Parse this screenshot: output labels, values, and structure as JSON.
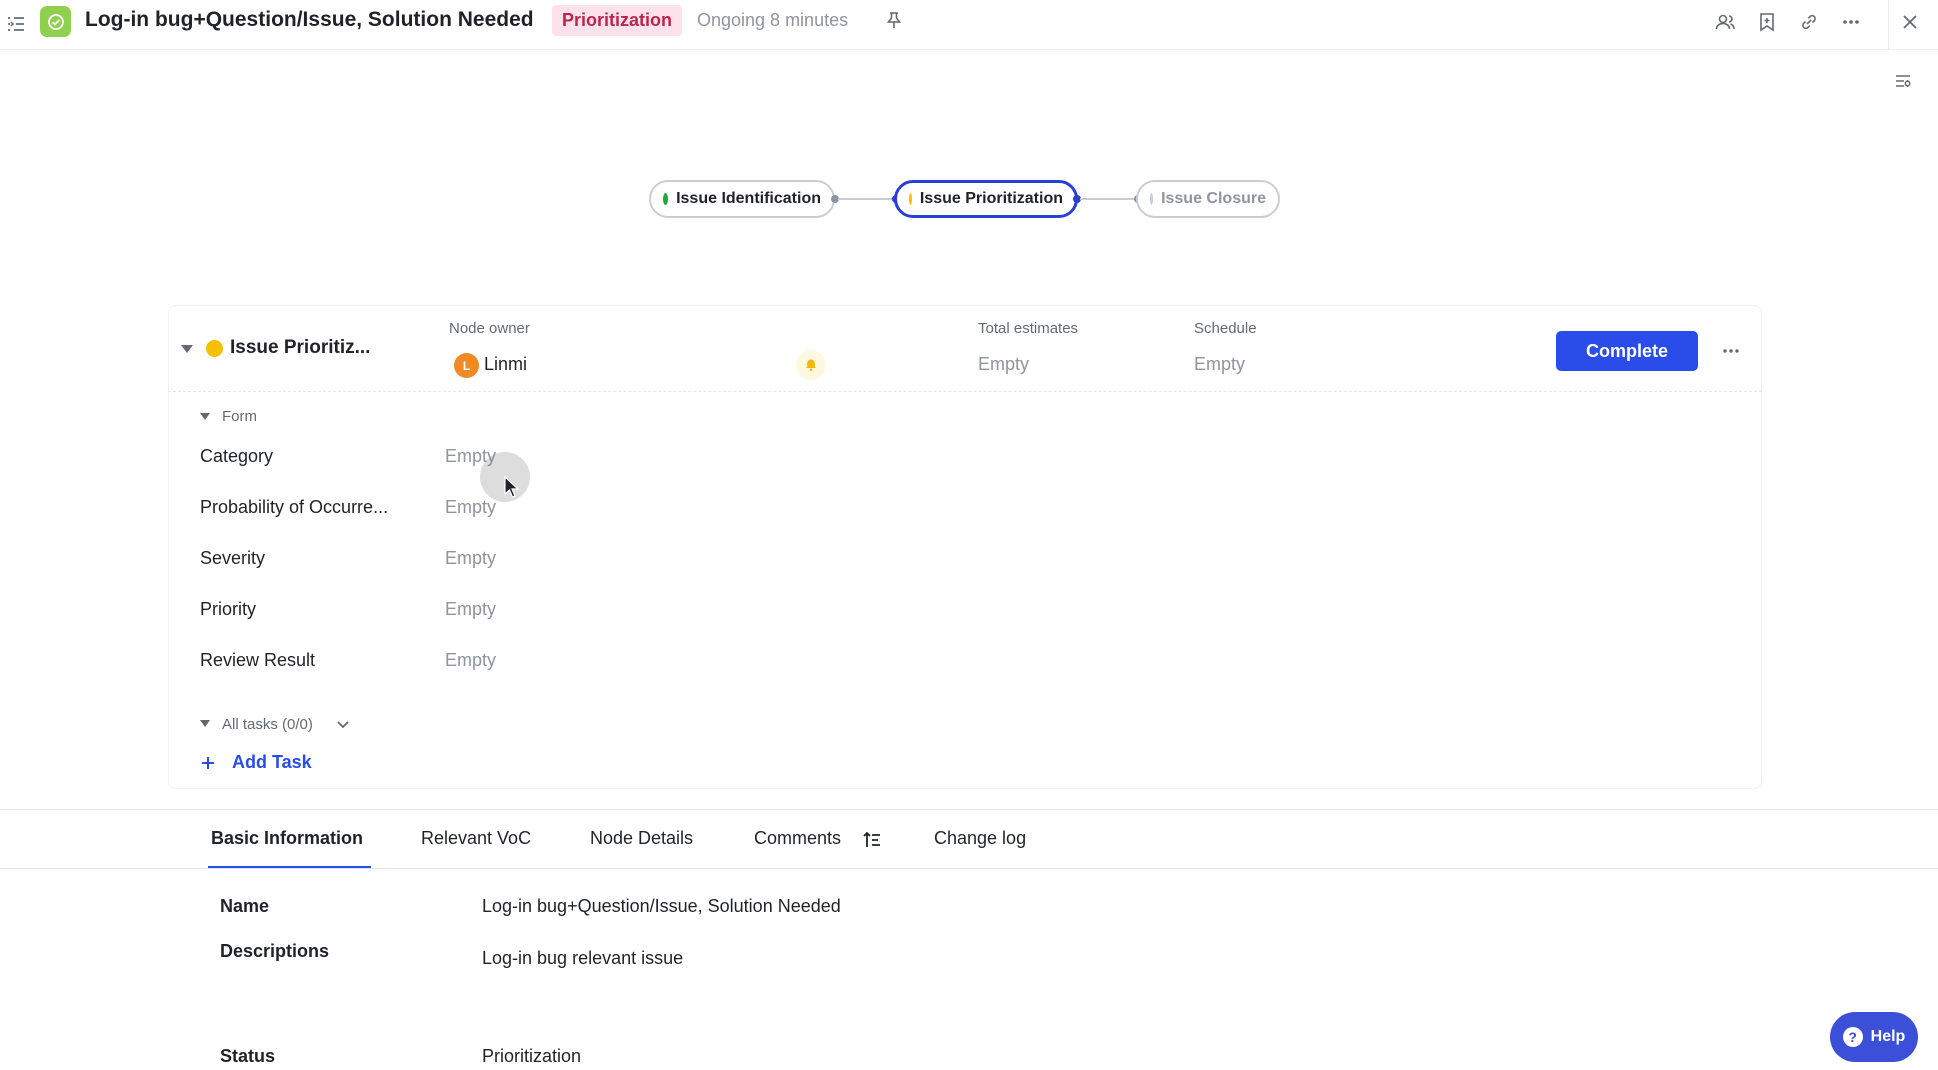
{
  "header": {
    "title": "Log-in bug+Question/Issue, Solution Needed",
    "stage_badge": "Prioritization",
    "ongoing": "Ongoing 8 minutes"
  },
  "flow": {
    "nodes": [
      {
        "label": "Issue Identification",
        "dot_color": "#22a83a"
      },
      {
        "label": "Issue Prioritization",
        "dot_color": "#f5c000"
      },
      {
        "label": "Issue Closure",
        "dot_color": "#c9cdd4"
      }
    ]
  },
  "node_card": {
    "title": "Issue Prioritiz...",
    "owner_label": "Node owner",
    "owner_initial": "L",
    "owner_name": "Linmi",
    "estimates_label": "Total estimates",
    "estimates_value": "Empty",
    "schedule_label": "Schedule",
    "schedule_value": "Empty",
    "complete_label": "Complete",
    "form_label": "Form",
    "fields": [
      {
        "label": "Category",
        "value": "Empty"
      },
      {
        "label": "Probability of Occurre...",
        "value": "Empty"
      },
      {
        "label": "Severity",
        "value": "Empty"
      },
      {
        "label": "Priority",
        "value": "Empty"
      },
      {
        "label": "Review Result",
        "value": "Empty"
      }
    ],
    "tasks_label": "All tasks (0/0)",
    "add_task_label": "Add Task"
  },
  "tabs": [
    {
      "label": "Basic Information",
      "active": true
    },
    {
      "label": "Relevant VoC",
      "active": false
    },
    {
      "label": "Node Details",
      "active": false
    },
    {
      "label": "Comments",
      "active": false
    },
    {
      "label": "Change log",
      "active": false
    }
  ],
  "basic_info": {
    "name_label": "Name",
    "name_value": "Log-in bug+Question/Issue, Solution Needed",
    "desc_label": "Descriptions",
    "desc_value": "Log-in bug relevant issue",
    "status_label": "Status",
    "status_value": "Prioritization"
  },
  "help": {
    "label": "Help"
  },
  "colors": {
    "accent": "#2a4ce8",
    "badge_bg": "#fde2ec",
    "badge_text": "#b8264e",
    "logo": "#8fd14f"
  }
}
